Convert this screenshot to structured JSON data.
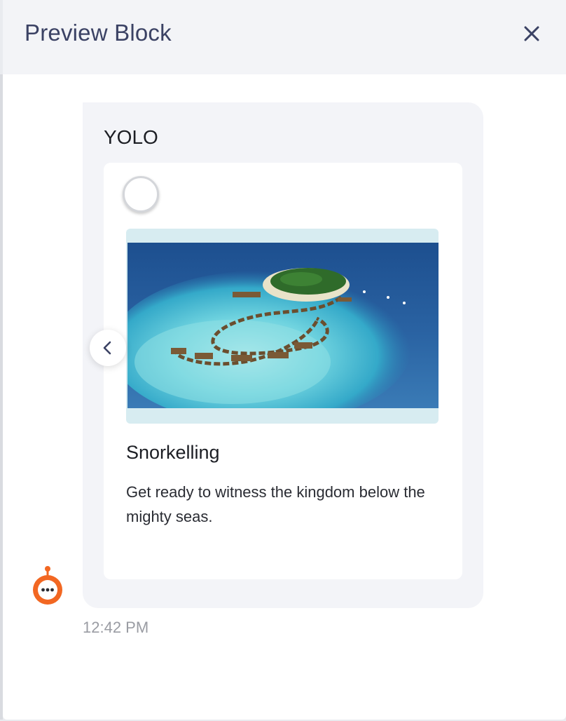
{
  "header": {
    "title": "Preview Block",
    "close_icon": "close-icon"
  },
  "message": {
    "title": "YOLO",
    "timestamp": "12:42 PM",
    "avatar_icon": "bot-avatar-icon",
    "carousel": {
      "prev_icon": "chevron-left-icon",
      "card": {
        "image_alt": "Aerial view of overwater villas on an island",
        "title": "Snorkelling",
        "description": "Get ready to witness the kingdom below the mighty seas."
      }
    }
  },
  "colors": {
    "accent": "#f26722",
    "title_text": "#3b4264",
    "bubble_bg": "#f3f4f8"
  }
}
